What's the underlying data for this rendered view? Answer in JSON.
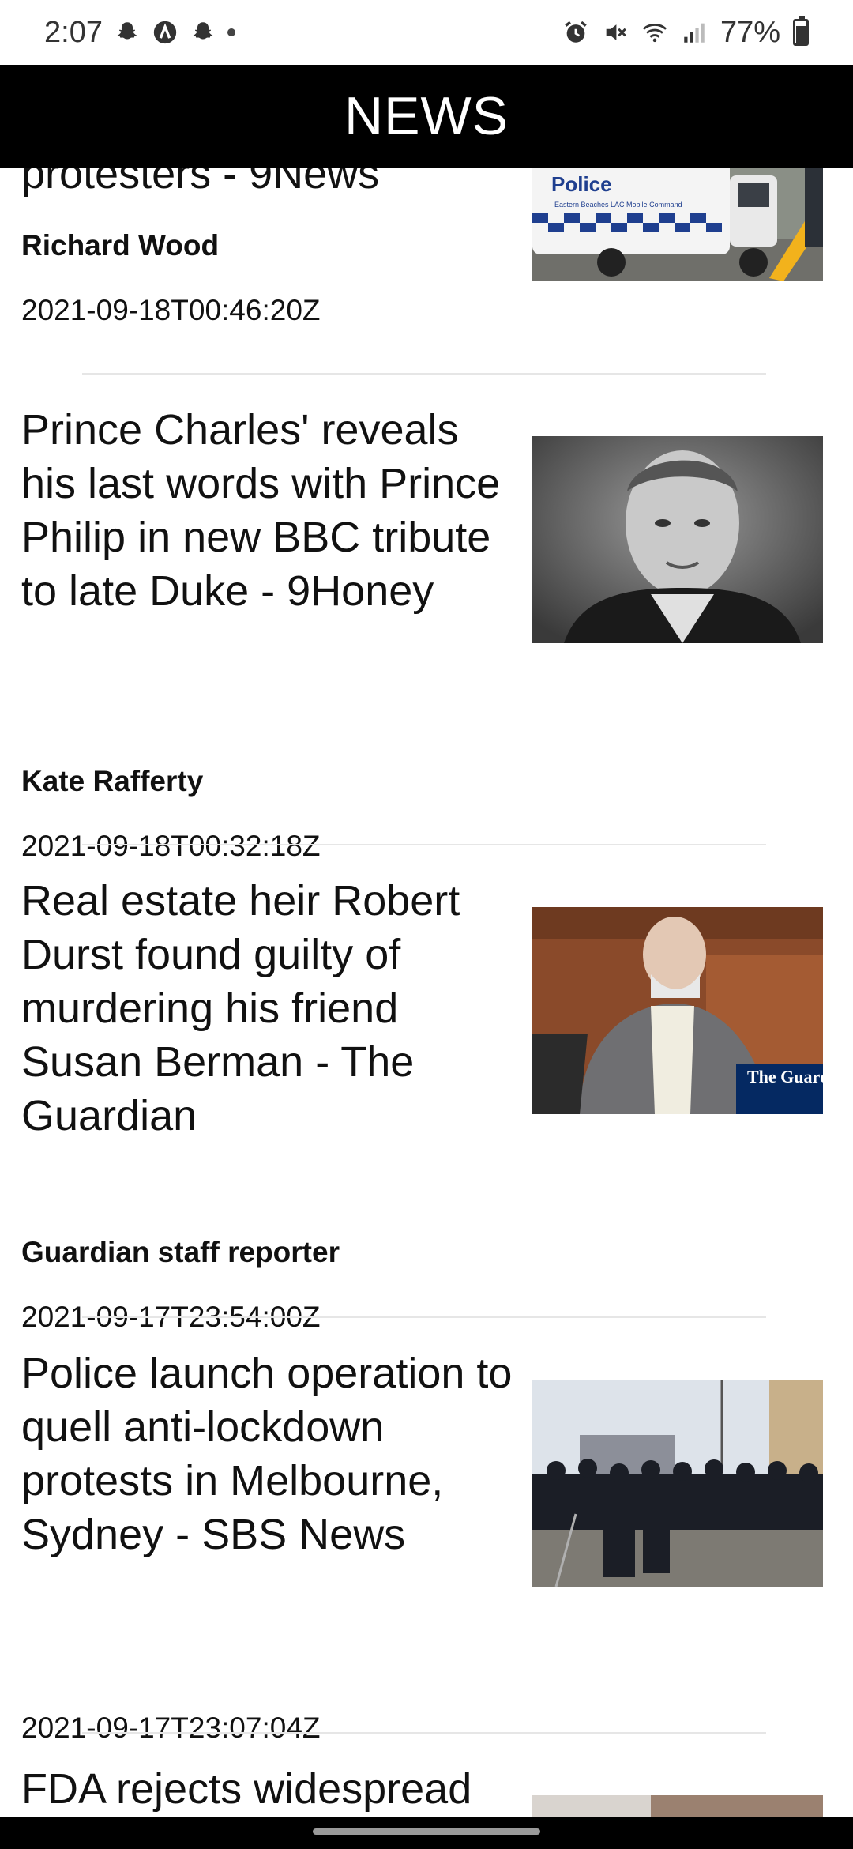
{
  "status_bar": {
    "time": "2:07",
    "battery": "77%",
    "left_icons": [
      "snapchat-icon",
      "app-a-icon",
      "snapchat-icon",
      "dot-icon"
    ],
    "right_icons": [
      "alarm-icon",
      "mute-icon",
      "wifi-icon",
      "signal-icon",
      "battery-icon"
    ]
  },
  "app_bar": {
    "title": "NEWS"
  },
  "articles": [
    {
      "headline": "protesters - 9News",
      "author": "Richard Wood",
      "timestamp": "2021-09-18T00:46:20Z",
      "image": "police-van-photo",
      "image_text": "Police",
      "image_subtext": "Eastern Beaches LAC Mobile Command"
    },
    {
      "headline": "Prince Charles' reveals his last words with Prince Philip in new BBC tribute to late Duke - 9Honey",
      "author": "Kate Rafferty",
      "timestamp": "2021-09-18T00:32:18Z",
      "image": "prince-philip-portrait-photo"
    },
    {
      "headline": "Real estate heir Robert Durst found guilty of murdering his friend Susan Berman - The Guardian",
      "author": "Guardian staff reporter",
      "timestamp": "2021-09-17T23:54:00Z",
      "image": "robert-durst-courtroom-photo",
      "image_text": "The Guardi"
    },
    {
      "headline": "Police launch operation to quell anti-lockdown protests in Melbourne, Sydney - SBS News",
      "author": "",
      "timestamp": "2021-09-17T23:07:04Z",
      "image": "riot-police-line-photo"
    },
    {
      "headline": "FDA rejects widespread",
      "author": "",
      "timestamp": "",
      "image": "face-closeup-photo"
    }
  ],
  "colors": {
    "app_bar_bg": "#000000",
    "app_bar_text": "#ffffff",
    "divider": "#e6e6e6"
  }
}
